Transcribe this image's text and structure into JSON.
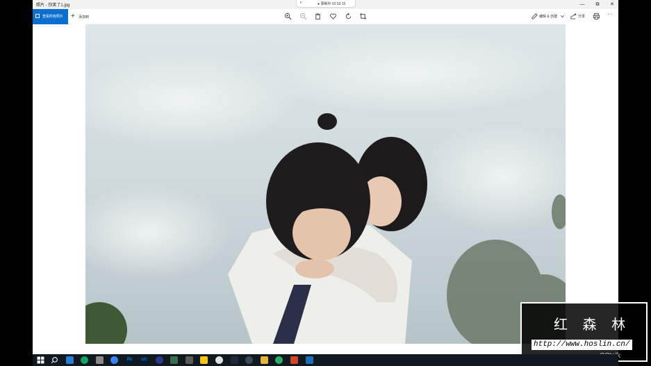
{
  "window": {
    "title": "照片 - 你笑了1.jpg",
    "minimize_glyph": "—",
    "maximize_glyph": "⧉",
    "close_glyph": "✕"
  },
  "recording": {
    "status": "● 录制中 02:03:15",
    "icon": "microphone-icon"
  },
  "toolbar": {
    "view_all_label": "查看所有照片",
    "add_to_label": "添加到",
    "add_glyph": "+",
    "edit_create_label": "编辑 & 创建",
    "share_label": "分享",
    "more_glyph": "···",
    "icons": [
      "zoom-in-icon",
      "zoom-out-icon",
      "delete-icon",
      "favorite-icon",
      "rotate-icon",
      "crop-icon",
      "print-icon"
    ]
  },
  "watermark": {
    "chars": "红 森 林",
    "url": "http://www.hoslin.cn/",
    "cctalk": "CCtalk"
  },
  "taskbar": {
    "icons": [
      "windows-start-icon",
      "search-icon",
      "app-icon",
      "browser-icon",
      "app-icon",
      "chrome-icon",
      "photoshop-icon",
      "app-icon",
      "app-icon",
      "app-icon",
      "app-icon",
      "app-icon",
      "app-icon",
      "app-icon",
      "app-icon",
      "folder-icon",
      "wechat-icon",
      "app-icon",
      "photos-icon"
    ],
    "photoshop_label": "Ps",
    "app_label": "LrC"
  }
}
